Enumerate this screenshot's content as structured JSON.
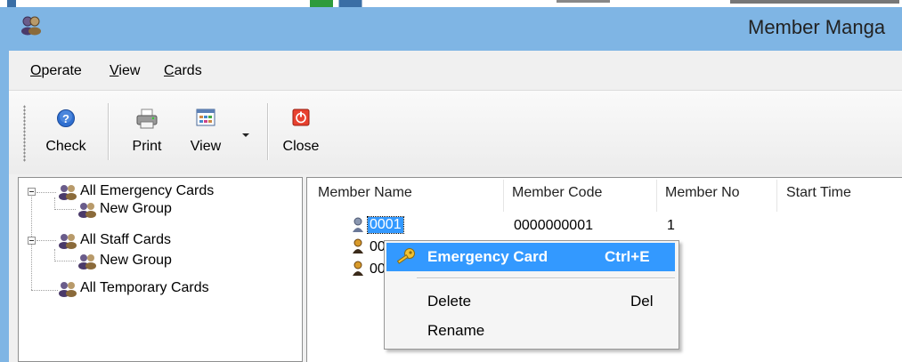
{
  "window": {
    "title": "Member Manga"
  },
  "menu": {
    "operate": {
      "pre": "",
      "ul": "O",
      "post": "perate"
    },
    "view": {
      "pre": "",
      "ul": "V",
      "post": "iew"
    },
    "cards": {
      "pre": "",
      "ul": "C",
      "post": "ards"
    }
  },
  "toolbar": {
    "check": "Check",
    "print": "Print",
    "view": "View",
    "close": "Close"
  },
  "tree": {
    "nodes": [
      {
        "label": "All Emergency Cards"
      },
      {
        "label": "New Group"
      },
      {
        "label": "All Staff Cards"
      },
      {
        "label": "New Group"
      },
      {
        "label": "All Temporary Cards"
      }
    ]
  },
  "list": {
    "columns": [
      "Member Name",
      "Member Code",
      "Member No",
      "Start Time"
    ],
    "rows": [
      {
        "name": "0001",
        "code": "0000000001",
        "no": "1"
      },
      {
        "name": "00",
        "code": "",
        "no": ""
      },
      {
        "name": "00",
        "code": "",
        "no": ""
      }
    ]
  },
  "context_menu": {
    "items": [
      {
        "label": "Emergency Card",
        "shortcut": "Ctrl+E",
        "highlighted": true
      },
      {
        "label": "Delete",
        "shortcut": "Del"
      },
      {
        "label": "Rename",
        "shortcut": ""
      }
    ]
  },
  "colors": {
    "titlebar": "#7fb5e4",
    "selection": "#3399ff",
    "close_icon": "#e8412f"
  }
}
